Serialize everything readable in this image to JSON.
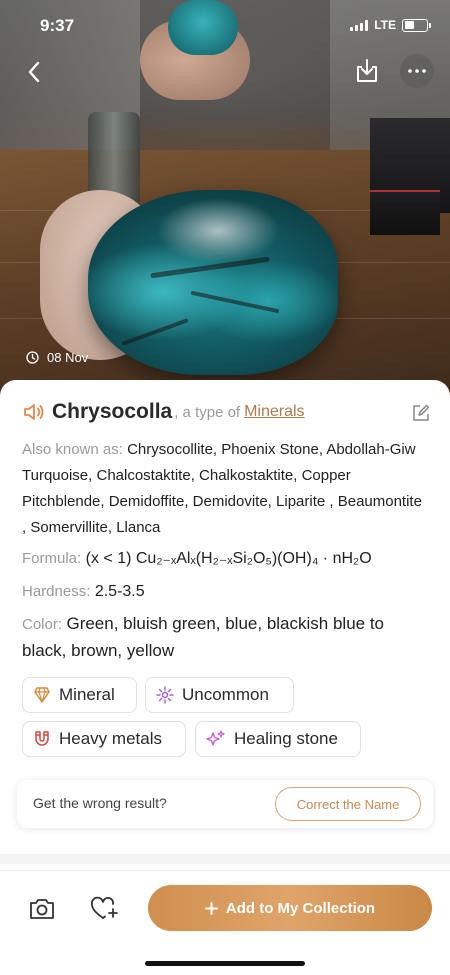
{
  "status_bar": {
    "time": "9:37",
    "network": "LTE"
  },
  "photo": {
    "date": "08 Nov"
  },
  "header_actions": {
    "back_icon": "chevron-left-icon",
    "download_icon": "download-icon",
    "more_icon": "more-dots-icon"
  },
  "mineral": {
    "name": "Chrysocolla",
    "type_prefix": ", a type of",
    "type_link": "Minerals",
    "also_known_label": "Also known as:",
    "also_known_value": "Chrysocollite, Phoenix Stone, Abdollah-Giw Turquoise, Chalcostaktite, Chalkostaktite, Copper Pitchblende, Demidoffite, Demidovite, Liparite , Beaumontite , Somervillite, Llanca",
    "formula_label": "Formula:",
    "formula_value": "(x < 1) Cu₂₋ₓAlₓ(H₂₋ₓSi₂O₅)(OH)₄ · nH₂O",
    "hardness_label": "Hardness:",
    "hardness_value": "2.5-3.5",
    "color_label": "Color:",
    "color_value": "Green, bluish green, blue, blackish blue to black, brown, yellow"
  },
  "tags": [
    {
      "label": "Mineral",
      "icon": "crystal-icon",
      "color": "#d8893a"
    },
    {
      "label": "Uncommon",
      "icon": "sparkle-icon",
      "color": "#a95fd6"
    },
    {
      "label": "Heavy metals",
      "icon": "magnet-icon",
      "color": "#d6453f"
    },
    {
      "label": "Healing stone",
      "icon": "healing-sparkle-icon",
      "color": "#c85fd0"
    }
  ],
  "feedback": {
    "prompt": "Get the wrong result?",
    "button": "Correct the Name"
  },
  "bottom_bar": {
    "add_button": "Add to My Collection"
  },
  "colors": {
    "accent": "#d09050",
    "link": "#b07a4f"
  }
}
